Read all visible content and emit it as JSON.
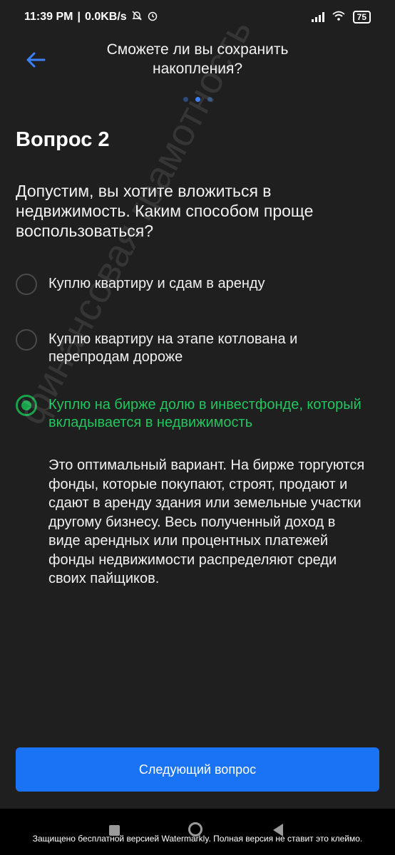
{
  "status_bar": {
    "time": "11:39 PM",
    "speed": "0.0KB/s",
    "battery": "75",
    "icons": [
      "mute-bell-icon",
      "alarm-icon",
      "signal-icon",
      "wifi-icon",
      "battery-icon"
    ]
  },
  "header": {
    "title": "Сможете ли вы сохранить накопления?",
    "back_icon": "arrow-left-icon",
    "accent_color": "#3b82f6"
  },
  "progress": {
    "total": 3,
    "current": 2
  },
  "question": {
    "number_label": "Вопрос 2",
    "text": "Допустим, вы хотите вложиться в недвижимость. Каким способом проще воспользоваться?"
  },
  "options": [
    {
      "label": "Куплю квартиру и сдам в аренду",
      "selected": false
    },
    {
      "label": "Куплю квартиру на этапе котлована и перепродам дороже",
      "selected": false
    },
    {
      "label": "Куплю на бирже долю в инвестфонде, который вкладывается в недвижимость",
      "selected": true,
      "color": "#22c55e"
    }
  ],
  "explanation": "Это оптимальный вариант. На бирже торгуются фонды, которые покупают, строят, продают и сдают в аренду здания или земельные участки другому бизнесу. Весь полученный доход в виде арендных или процентных платежей фонды недвижимости распределяют среди своих пайщиков.",
  "next_button": {
    "label": "Следующий вопрос",
    "color": "#1a73f5"
  },
  "watermarks": {
    "diagonal": "финансовая грамотность",
    "banner": "Защищено бесплатной версией Watermarkly. Полная версия не ставит это клеймо."
  }
}
